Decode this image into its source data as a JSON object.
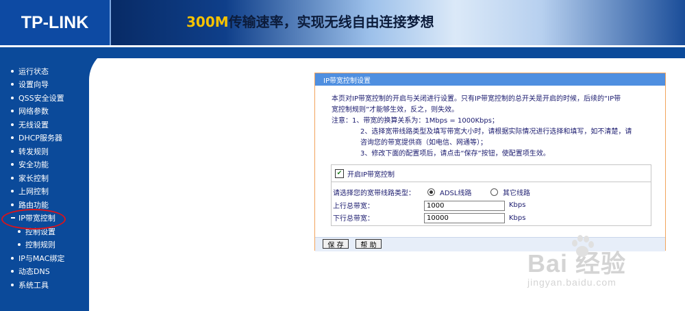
{
  "header": {
    "logo": "TP-LINK",
    "banner_num": "300M",
    "banner_text": "传输速率，实现无线自由连接梦想"
  },
  "sidebar": {
    "items": [
      {
        "label": "运行状态"
      },
      {
        "label": "设置向导"
      },
      {
        "label": "QSS安全设置"
      },
      {
        "label": "网络参数"
      },
      {
        "label": "无线设置"
      },
      {
        "label": "DHCP服务器"
      },
      {
        "label": "转发规则"
      },
      {
        "label": "安全功能"
      },
      {
        "label": "家长控制"
      },
      {
        "label": "上网控制"
      },
      {
        "label": "路由功能"
      },
      {
        "label": "IP带宽控制"
      },
      {
        "label": "控制设置"
      },
      {
        "label": "控制规则"
      },
      {
        "label": "IP与MAC绑定"
      },
      {
        "label": "动态DNS"
      },
      {
        "label": "系统工具"
      }
    ]
  },
  "panel": {
    "title": "IP带宽控制设置",
    "intro1": "本页对IP带宽控制的开启与关闭进行设置。只有IP带宽控制的总开关是开启的时候，后续的“IP带",
    "intro2": "宽控制规则”才能够生效，反之，则失效。",
    "note_label": "注意：",
    "note1": "1、带宽的换算关系为：1Mbps = 1000Kbps；",
    "note2a": "2、选择宽带线路类型及填写带宽大小时，请根据实际情况进行选择和填写，如不清楚，请",
    "note2b": "咨询您的带宽提供商（如电信、网通等）；",
    "note3": "3、修改下面的配置项后，请点击“保存”按钮，使配置项生效。",
    "enable_label": "开启IP带宽控制",
    "enable_check": "✔",
    "line_type_label": "请选择您的宽带线路类型：",
    "radio_adsl": "ADSL线路",
    "radio_other": "其它线路",
    "up_label": "上行总带宽：",
    "up_value": "1000",
    "down_label": "下行总带宽：",
    "down_value": "10000",
    "unit": "Kbps",
    "save_label": "保 存",
    "help_label": "帮 助"
  },
  "watermark": {
    "main": "Bai 经验",
    "url": "jingyan.baidu.com"
  }
}
